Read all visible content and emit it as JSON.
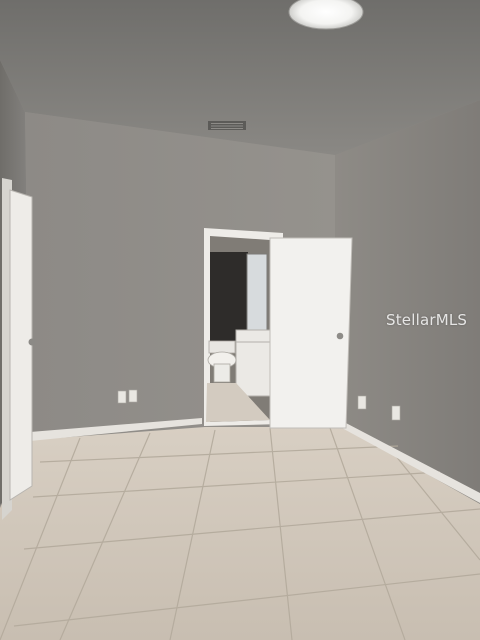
{
  "photo": {
    "watermark": "StellarMLS"
  }
}
